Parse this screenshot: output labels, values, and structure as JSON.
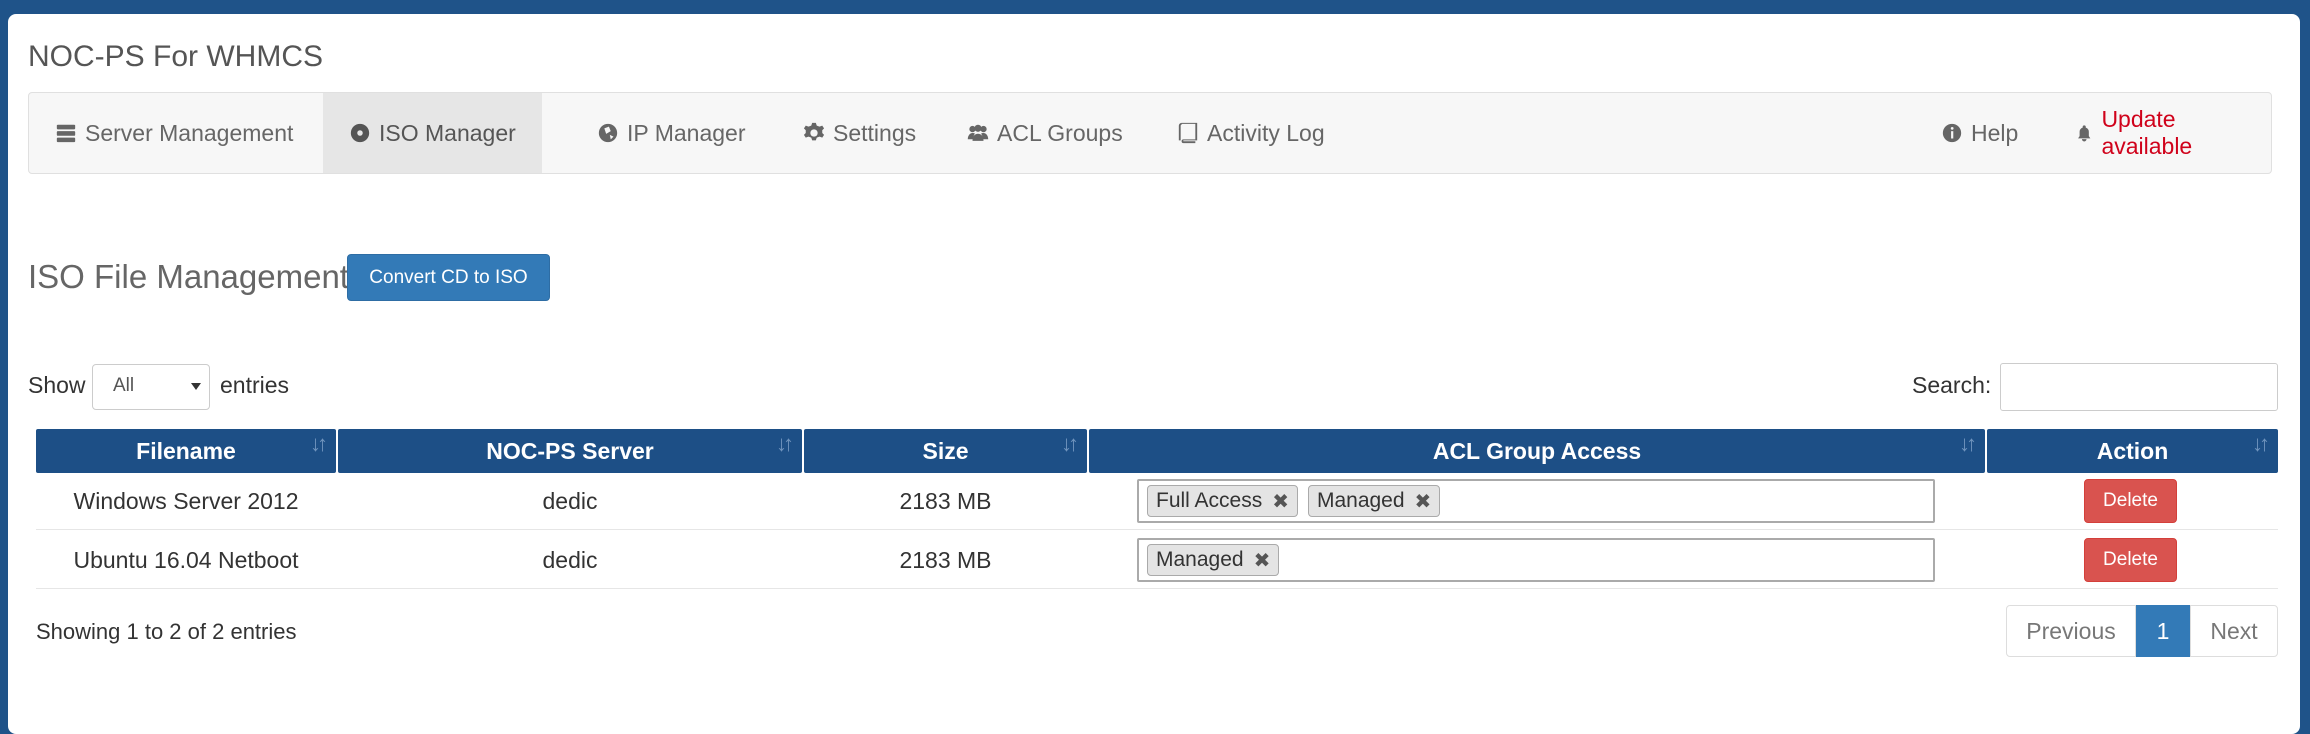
{
  "app": {
    "title": "NOC-PS For WHMCS"
  },
  "nav": {
    "items": [
      {
        "label": "Server Management",
        "icon": "server-icon"
      },
      {
        "label": "ISO Manager",
        "icon": "disc-icon",
        "active": true
      },
      {
        "label": "IP Manager",
        "icon": "globe-icon"
      },
      {
        "label": "Settings",
        "icon": "gear-icon"
      },
      {
        "label": "ACL Groups",
        "icon": "users-icon"
      },
      {
        "label": "Activity Log",
        "icon": "book-icon"
      }
    ],
    "right": [
      {
        "label": "Help",
        "icon": "info-icon"
      },
      {
        "label": "Update available",
        "icon": "bell-icon",
        "color": "#d0021b"
      }
    ]
  },
  "section": {
    "title": "ISO File Management",
    "convert_button": "Convert CD to ISO"
  },
  "length_menu": {
    "show_label": "Show",
    "selected": "All",
    "entries_label": "entries"
  },
  "search": {
    "label": "Search:",
    "value": ""
  },
  "table": {
    "columns": [
      "Filename",
      "NOC-PS Server",
      "Size",
      "ACL Group Access",
      "Action"
    ],
    "rows": [
      {
        "filename": "Windows Server 2012",
        "server": "dedic",
        "size": "2183 MB",
        "acl": [
          "Full Access",
          "Managed"
        ],
        "action": "Delete"
      },
      {
        "filename": "Ubuntu 16.04 Netboot",
        "server": "dedic",
        "size": "2183 MB",
        "acl": [
          "Managed"
        ],
        "action": "Delete"
      }
    ]
  },
  "footer": {
    "info": "Showing 1 to 2 of 2 entries",
    "pagination": {
      "previous": "Previous",
      "current": "1",
      "next": "Next"
    }
  },
  "colors": {
    "header_bg": "#1d4f86",
    "primary": "#337ab7",
    "danger": "#d9534f",
    "alert_text": "#d0021b",
    "frame": "#1f5389"
  }
}
